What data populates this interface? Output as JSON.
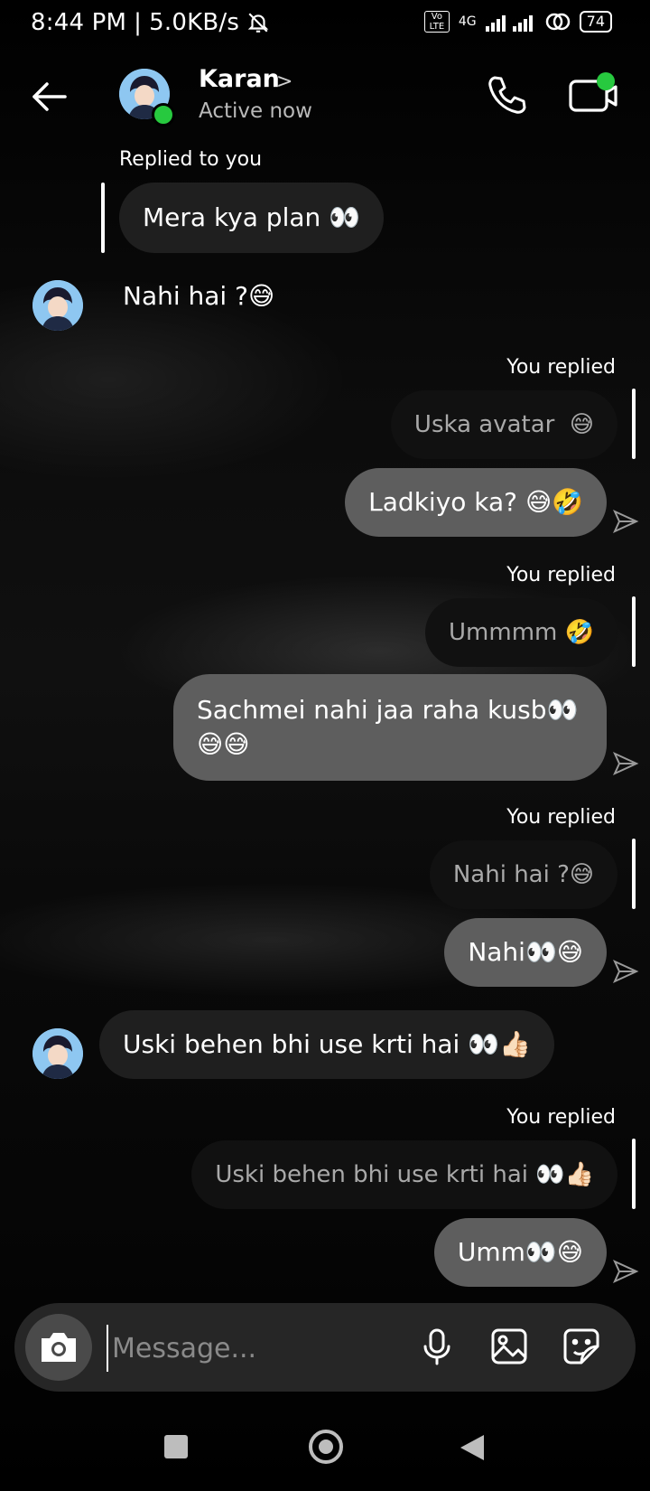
{
  "status_bar": {
    "time": "8:44 PM",
    "separator": "|",
    "speed": "5.0KB/s",
    "network": "4G",
    "volte": "Vo LTE",
    "battery": "74"
  },
  "header": {
    "contact_name": "Karan",
    "presence": "Active now"
  },
  "messages": {
    "m1": {
      "reply_label": "Replied to you",
      "quoted": "Mera kya plan 👀"
    },
    "m2": {
      "text": "Nahi hai ?😅"
    },
    "m3": {
      "reply_label": "You replied",
      "quoted": "Uska avatar  😅",
      "text": "Ladkiyo ka? 😅🤣"
    },
    "m4": {
      "reply_label": "You replied",
      "quoted": "Ummmm 🤣",
      "text": "Sachmei nahi jaa raha kusb👀\n😅😅"
    },
    "m5": {
      "reply_label": "You replied",
      "quoted": "Nahi hai ?😅",
      "text": "Nahi👀😅"
    },
    "m6": {
      "text": "Uski behen bhi use krti hai 👀👍🏻"
    },
    "m7": {
      "reply_label": "You replied",
      "quoted": "Uski behen bhi use krti hai 👀👍🏻",
      "text": "Umm👀😅"
    }
  },
  "composer": {
    "placeholder": "Message..."
  },
  "icons": {
    "back": "arrow-left-icon",
    "call": "phone-icon",
    "video": "video-camera-icon",
    "camera": "camera-icon",
    "mic": "microphone-icon",
    "gallery": "image-icon",
    "sticker": "sticker-icon",
    "sent": "send-arrow-icon"
  },
  "colors": {
    "online": "#27c93f",
    "outgoing_bubble": "#5e5e5e",
    "incoming_bubble": "#1f1f1f"
  }
}
